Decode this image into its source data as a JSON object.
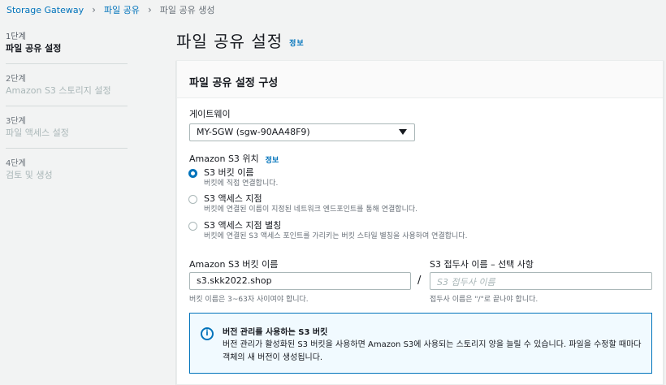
{
  "breadcrumb": {
    "items": [
      "Storage Gateway",
      "파일 공유",
      "파일 공유 생성"
    ]
  },
  "steps": [
    {
      "num": "1단계",
      "title": "파일 공유 설정"
    },
    {
      "num": "2단계",
      "title": "Amazon S3 스토리지 설정"
    },
    {
      "num": "3단계",
      "title": "파일 액세스 설정"
    },
    {
      "num": "4단계",
      "title": "검토 및 생성"
    }
  ],
  "page": {
    "title": "파일 공유 설정",
    "info": "정보"
  },
  "panel": {
    "header": "파일 공유 설정 구성",
    "gateway_label": "게이트웨이",
    "gateway_value": "MY-SGW (sgw-90AA48F9)",
    "s3_location_label": "Amazon S3 위치",
    "s3_location_info": "정보",
    "radios": [
      {
        "title": "S3 버킷 이름",
        "desc": "버킷에 직접 연결합니다.",
        "checked": true
      },
      {
        "title": "S3 액세스 지점",
        "desc": "버킷에 연결된 이름이 지정된 네트워크 엔드포인트를 통해 연결합니다.",
        "checked": false
      },
      {
        "title": "S3 액세스 지점 별칭",
        "desc": "버킷에 연결된 S3 액세스 포인트를 가리키는 버킷 스타일 별칭을 사용하여 연결합니다.",
        "checked": false
      }
    ],
    "bucket_label": "Amazon S3 버킷 이름",
    "bucket_value": "s3.skk2022.shop",
    "bucket_hint": "버킷 이름은 3~63자 사이여야 합니다.",
    "slash": "/",
    "prefix_label": "S3 접두사 이름 – 선택 사항",
    "prefix_placeholder": "S3 접두사 이름",
    "prefix_hint": "접두사 이름은 \"/\"로 끝나야 합니다.",
    "alert": {
      "icon": "info-icon",
      "title": "버전 관리를 사용하는 S3 버킷",
      "body": "버전 관리가 활성화된 S3 버킷을 사용하면 Amazon S3에 사용되는 스토리지 양을 늘릴 수 있습니다. 파일을 수정할 때마다 객체의 새 버전이 생성됩니다."
    }
  },
  "colors": {
    "link": "#0073bb",
    "background": "#f2f3f3",
    "alert_bg": "#f1faff"
  }
}
